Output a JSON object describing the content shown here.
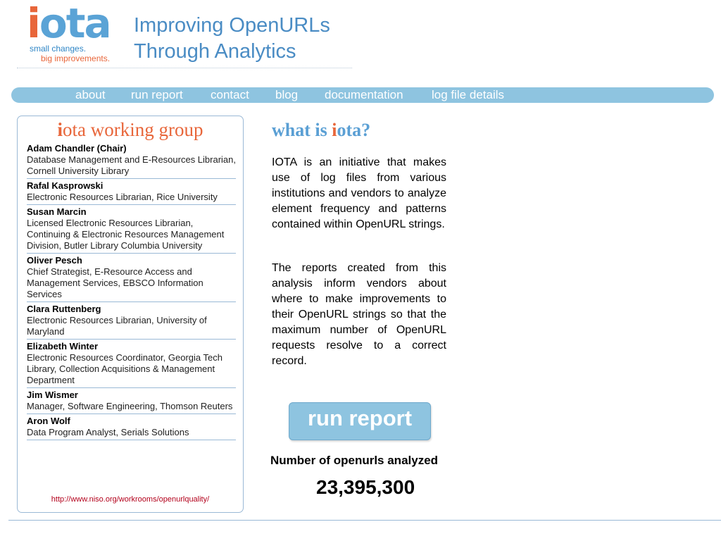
{
  "header": {
    "logo_i": "i",
    "logo_ota": "ota",
    "tagline_1": "small changes.",
    "tagline_2": "big improvements.",
    "title_line_1": "Improving OpenURLs",
    "title_line_2": "Through Analytics"
  },
  "nav": {
    "items": [
      "about",
      "run report",
      "contact",
      "blog",
      "documentation",
      "log file details"
    ]
  },
  "working_group": {
    "title_i": "i",
    "title_rest": "ota working group",
    "members": [
      {
        "name": "Adam Chandler (Chair)",
        "title": "Database Management and E-Resources Librarian, Cornell University Library"
      },
      {
        "name": "Rafal Kasprowski",
        "title": "Electronic Resources Librarian, Rice University"
      },
      {
        "name": "Susan Marcin",
        "title": "Licensed Electronic Resources Librarian, Continuing & Electronic Resources Management Division, Butler Library Columbia University"
      },
      {
        "name": "Oliver Pesch",
        "title": "Chief Strategist, E-Resource Access and Management Services, EBSCO Information Services"
      },
      {
        "name": "Clara Ruttenberg",
        "title": "Electronic Resources Librarian, University of Maryland"
      },
      {
        "name": "Elizabeth Winter",
        "title": "Electronic Resources Coordinator, Georgia Tech Library, Collection Acquisitions & Management Department"
      },
      {
        "name": "Jim Wismer",
        "title": "Manager, Software Engineering, Thomson Reuters"
      },
      {
        "name": "Aron Wolf",
        "title": "Data Program Analyst, Serials Solutions"
      }
    ],
    "link": "http://www.niso.org/workrooms/openurlquality/"
  },
  "main": {
    "heading_pre": "what is ",
    "heading_i": "i",
    "heading_post": "ota?",
    "paragraph_1": "IOTA is an initiative that makes use of log files from various institutions and vendors to analyze element frequency and patterns contained within OpenURL strings.",
    "paragraph_2": "The reports created from this analysis inform vendors about where to make improvements to their OpenURL strings so that the maximum number of OpenURL requests resolve to a correct record.",
    "run_report_label": "run report",
    "count_label": "Number of openurls analyzed",
    "count_value": "23,395,300"
  },
  "colors": {
    "accent_blue": "#8ec4e0",
    "brand_orange": "#e8663a",
    "heading_blue": "#5a9fd4"
  }
}
